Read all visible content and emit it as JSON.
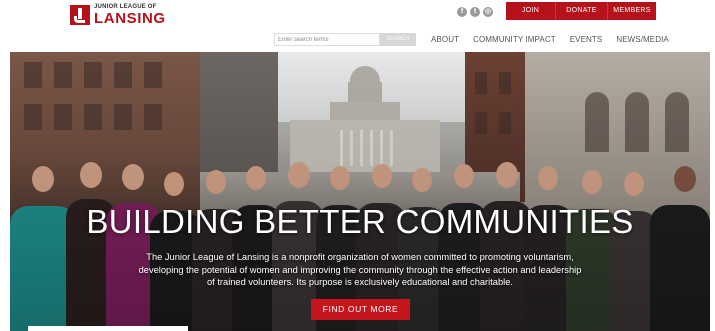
{
  "brand": {
    "small_text": "JUNIOR LEAGUE OF",
    "name": "LANSING",
    "color": "#b5121b"
  },
  "socials": [
    {
      "icon": "facebook-icon",
      "glyph": "f"
    },
    {
      "icon": "twitter-icon",
      "glyph": "t"
    },
    {
      "icon": "instagram-icon",
      "glyph": "◎"
    }
  ],
  "top_buttons": {
    "join": "JOIN",
    "donate": "DONATE",
    "members": "MEMBERS"
  },
  "search": {
    "placeholder": "Enter search terms",
    "button": "SEARCH"
  },
  "nav": {
    "about": "ABOUT",
    "community_impact": "COMMUNITY IMPACT",
    "events": "EVENTS",
    "news_media": "NEWS/MEDIA"
  },
  "hero": {
    "title": "BUILDING BETTER COMMUNITIES",
    "body": "The Junior League of Lansing is a nonprofit organization of women committed to promoting voluntarism, developing the potential of women and improving the community through the effective action and leadership of trained volunteers. Its purpose is exclusively educational and charitable.",
    "cta": "FIND OUT MORE",
    "accent_color": "#c4161c"
  }
}
